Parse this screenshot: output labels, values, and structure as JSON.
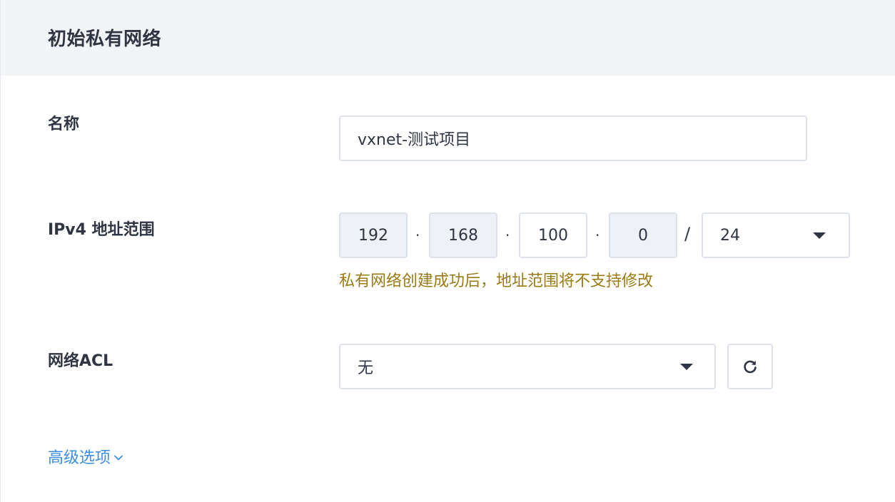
{
  "header": {
    "title": "初始私有网络"
  },
  "name_field": {
    "label": "名称",
    "value": "vxnet-测试项目"
  },
  "ipv4_field": {
    "label": "IPv4 地址范围",
    "octets": [
      "192",
      "168",
      "100",
      "0"
    ],
    "separator": "·",
    "slash": "/",
    "prefix": "24",
    "hint": "私有网络创建成功后，地址范围将不支持修改"
  },
  "acl_field": {
    "label": "网络ACL",
    "value": "无"
  },
  "advanced": {
    "label": "高级选项"
  },
  "icons": {
    "prefix_dropdown": "caret-down-icon",
    "acl_dropdown": "caret-down-icon",
    "refresh": "refresh-icon",
    "advanced_toggle": "chevron-down-icon"
  },
  "colors": {
    "header_bg": "#f3f4f8",
    "text": "#2f3542",
    "hint": "#9a7a12",
    "link": "#3d8fe0",
    "border": "#dde2ea",
    "readonly_bg": "#eef1f6"
  }
}
